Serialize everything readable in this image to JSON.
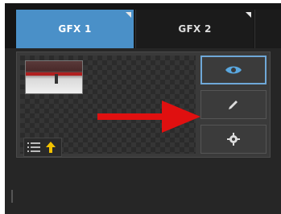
{
  "tabs": [
    {
      "label": "GFX 1",
      "active": true
    },
    {
      "label": "GFX 2",
      "active": false
    },
    {
      "label": "",
      "active": false
    }
  ],
  "colors": {
    "active_tab": "#4a90c8",
    "arrow": "#e01010",
    "icon": "#5aa8e0",
    "up_arrow": "#f2c200"
  },
  "slot": {
    "thumbnail_icon": "video-thumbnail",
    "buttons": [
      {
        "icon": "eye-icon",
        "active": true
      },
      {
        "icon": "pencil-icon",
        "active": false
      },
      {
        "icon": "gear-icon",
        "active": false
      }
    ],
    "tools": [
      "list-icon",
      "move-up-icon"
    ]
  }
}
